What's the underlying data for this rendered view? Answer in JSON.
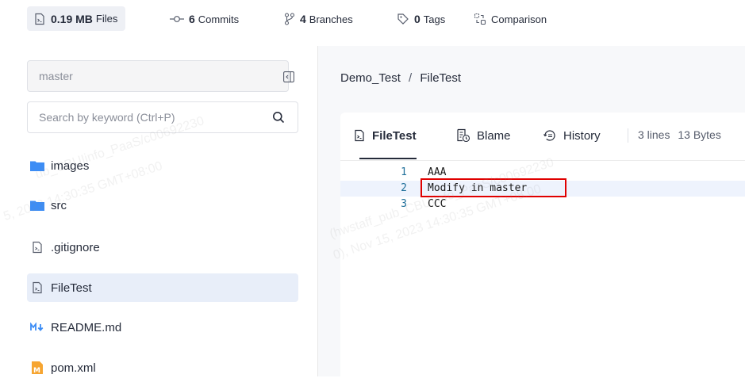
{
  "stats": {
    "files": {
      "value": "0.19 MB",
      "label": "Files"
    },
    "commits": {
      "value": "6",
      "label": "Commits"
    },
    "branches": {
      "value": "4",
      "label": "Branches"
    },
    "tags": {
      "value": "0",
      "label": "Tags"
    },
    "comparison": {
      "label": "Comparison"
    }
  },
  "sidebar": {
    "branch": "master",
    "search_placeholder": "Search by keyword (Ctrl+P)",
    "items": [
      {
        "name": "images",
        "icon": "folder-icon"
      },
      {
        "name": "src",
        "icon": "folder-icon"
      },
      {
        "name": ".gitignore",
        "icon": "file-icon"
      },
      {
        "name": "FileTest",
        "icon": "file-icon",
        "active": true
      },
      {
        "name": "README.md",
        "icon": "markdown-icon"
      },
      {
        "name": "pom.xml",
        "icon": "maven-icon"
      }
    ]
  },
  "breadcrumb": {
    "repo": "Demo_Test",
    "separator": "/",
    "file": "FileTest"
  },
  "tabs": {
    "file": "FileTest",
    "blame": "Blame",
    "history": "History"
  },
  "file_info": {
    "lines": "3 lines",
    "size": "13 Bytes"
  },
  "code": [
    {
      "num": "1",
      "text": "AAA"
    },
    {
      "num": "2",
      "text": "Modify in master"
    },
    {
      "num": "3",
      "text": "CCC"
    }
  ],
  "colors": {
    "accent_highlight": "#e00000",
    "active_item_bg": "#e8eef9",
    "folder": "#3d8df5"
  }
}
